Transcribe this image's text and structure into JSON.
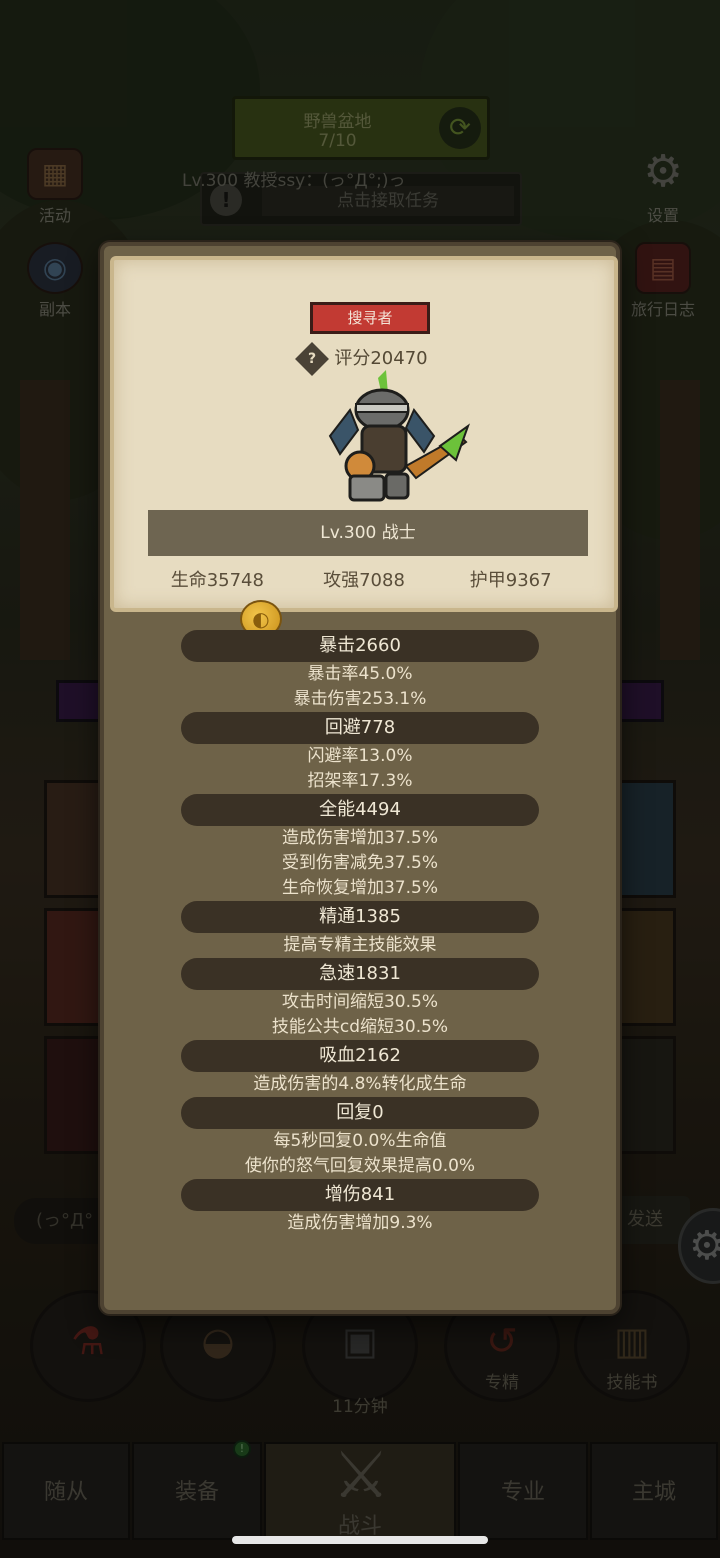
{
  "zone": {
    "name": "野兽盆地",
    "progress": "7/10"
  },
  "player": {
    "title_line": "Lv.300 教授ssy：(っ°Д°;)っ",
    "quest_text": "点击接取任务"
  },
  "side_menu": {
    "activity": "活动",
    "dungeon": "副本",
    "settings": "设置",
    "travel_log": "旅行日志"
  },
  "chat": {
    "input_text": "(っ°Д°",
    "send_label": "发送"
  },
  "actions": {
    "chest_timer": "11分钟",
    "mastery": "专精",
    "skill_book": "技能书"
  },
  "tabs": {
    "followers": "随从",
    "equipment": "装备",
    "battle": "战斗",
    "profession": "专业",
    "main_city": "主城"
  },
  "character": {
    "rank": "搜寻者",
    "score": "评分20470",
    "level_class": "Lv.300 战士",
    "hp": "生命35748",
    "attack": "攻强7088",
    "armor": "护甲9367"
  },
  "attributes": [
    {
      "name": "暴击2660",
      "details": [
        "暴击率45.0%",
        "暴击伤害253.1%"
      ]
    },
    {
      "name": "回避778",
      "details": [
        "闪避率13.0%",
        "招架率17.3%"
      ]
    },
    {
      "name": "全能4494",
      "details": [
        "造成伤害增加37.5%",
        "受到伤害减免37.5%",
        "生命恢复增加37.5%"
      ]
    },
    {
      "name": "精通1385",
      "details": [
        "提高专精主技能效果"
      ]
    },
    {
      "name": "急速1831",
      "details": [
        "攻击时间缩短30.5%",
        "技能公共cd缩短30.5%"
      ]
    },
    {
      "name": "吸血2162",
      "details": [
        "造成伤害的4.8%转化成生命"
      ]
    },
    {
      "name": "回复0",
      "details": [
        "每5秒回复0.0%生命值",
        "使你的怒气回复效果提高0.0%"
      ]
    },
    {
      "name": "增伤841",
      "details": [
        "造成伤害增加9.3%"
      ]
    }
  ]
}
